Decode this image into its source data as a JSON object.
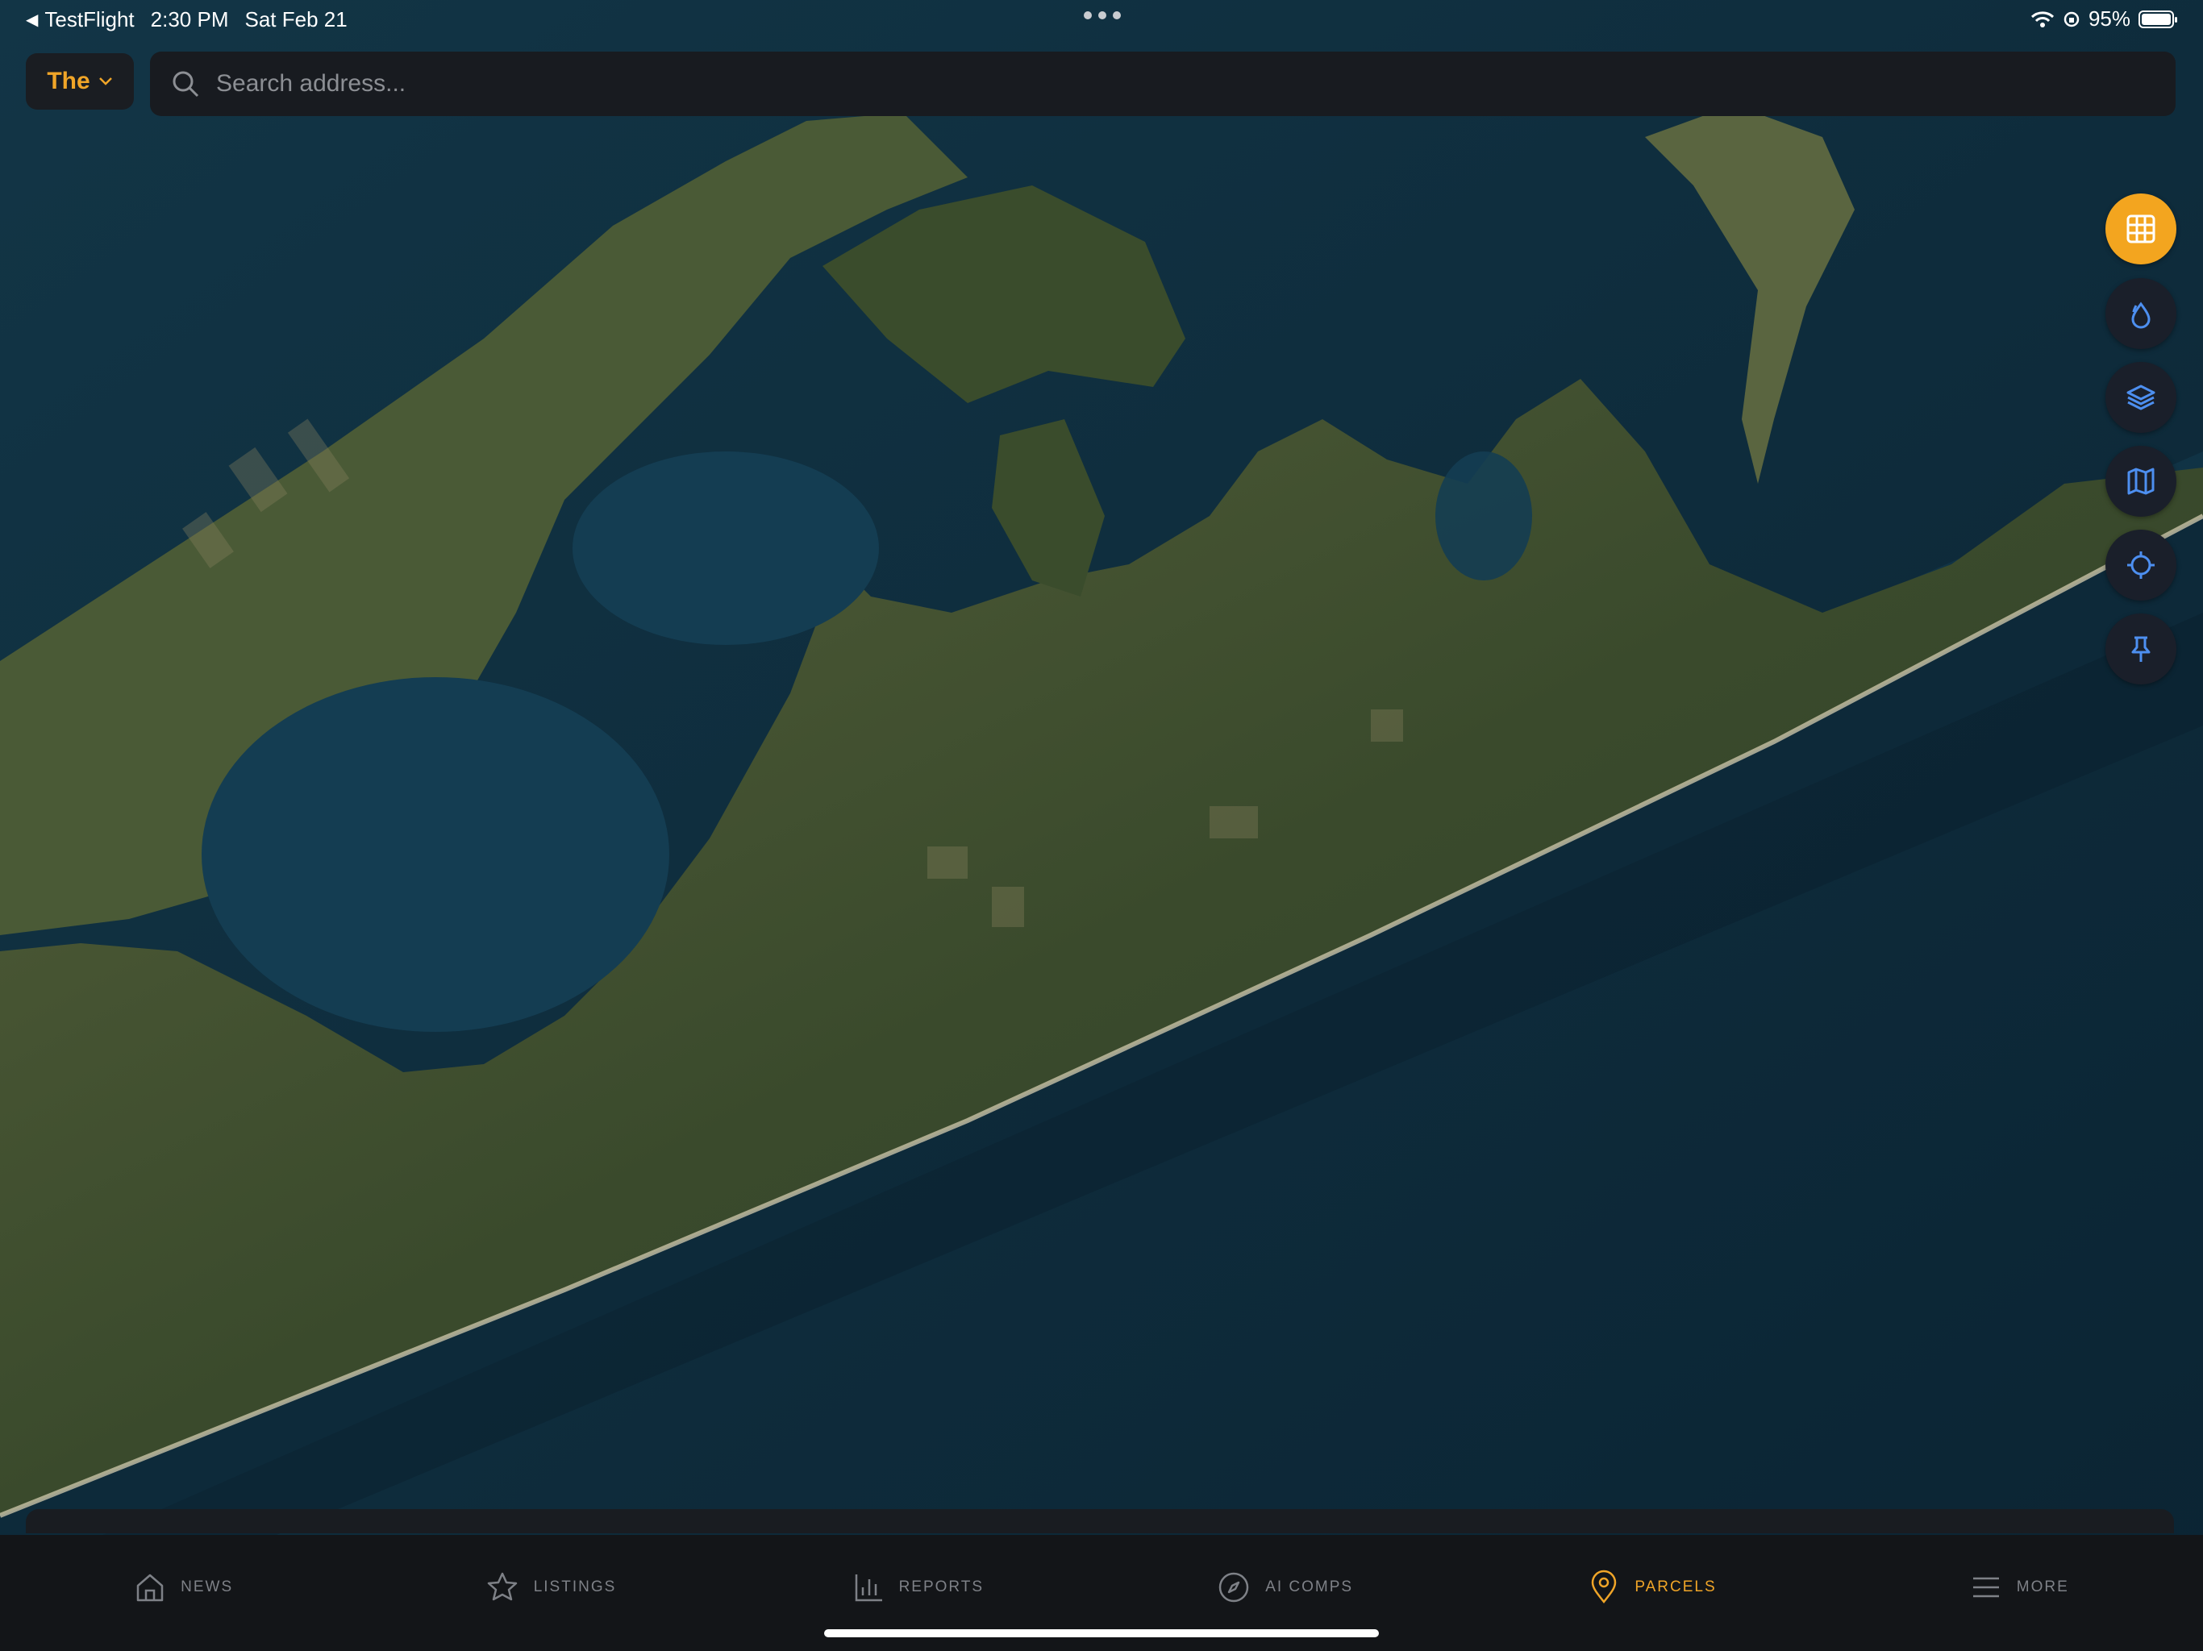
{
  "status_bar": {
    "back_app": "TestFlight",
    "time": "2:30 PM",
    "date": "Sat Feb 21",
    "battery": "95%"
  },
  "market_selector": {
    "label": "The"
  },
  "search": {
    "placeholder": "Search address..."
  },
  "map_controls": [
    {
      "icon": "grid-icon",
      "active": true
    },
    {
      "icon": "water-drop-icon",
      "active": false
    },
    {
      "icon": "layers-icon",
      "active": false
    },
    {
      "icon": "map-icon",
      "active": false
    },
    {
      "icon": "locate-icon",
      "active": false
    },
    {
      "icon": "pin-icon",
      "active": false
    }
  ],
  "tabs": [
    {
      "label": "NEWS",
      "icon": "home-icon",
      "active": false
    },
    {
      "label": "LISTINGS",
      "icon": "star-icon",
      "active": false
    },
    {
      "label": "REPORTS",
      "icon": "bar-chart-icon",
      "active": false
    },
    {
      "label": "AI COMPS",
      "icon": "compass-icon",
      "active": false
    },
    {
      "label": "PARCELS",
      "icon": "location-pin-icon",
      "active": true
    },
    {
      "label": "MORE",
      "icon": "menu-icon",
      "active": false
    }
  ],
  "colors": {
    "accent": "#f0a528",
    "tab_bar": "#131518",
    "ocean": "#0d2a3a",
    "land": "#3a4a2c"
  }
}
